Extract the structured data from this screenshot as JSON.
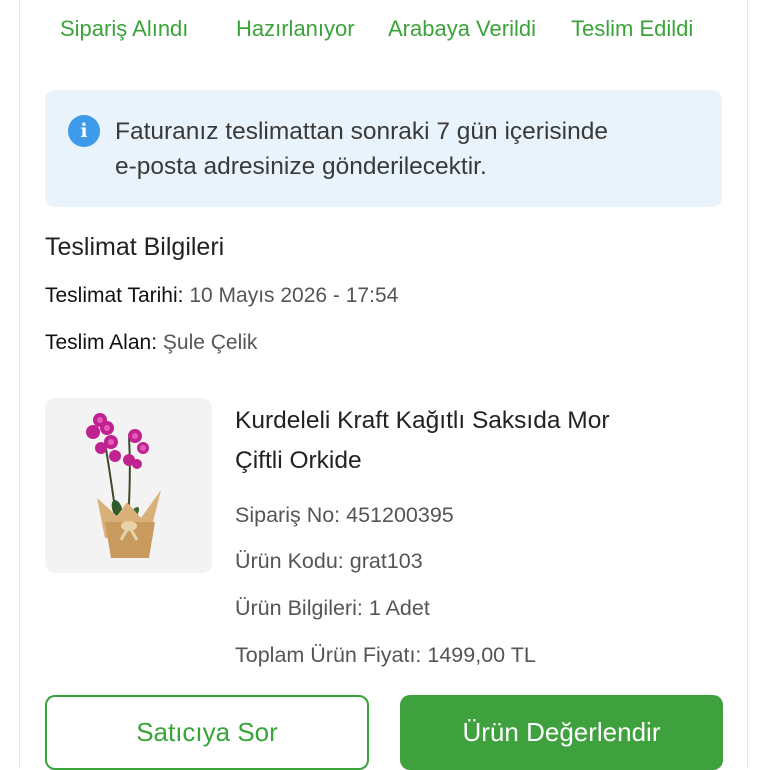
{
  "order_steps": [
    "Sipariş Alındı",
    "Hazırlanıyor",
    "Arabaya Verildi",
    "Teslim Edildi"
  ],
  "colors": {
    "accent": "#3aa33a",
    "info_bg": "#e9f3fb",
    "info_icon": "#3d9be9"
  },
  "info_notice": {
    "icon": "info-icon",
    "line1": "Faturanız teslimattan sonraki 7 gün içerisinde",
    "line2": "e-posta adresinize gönderilecektir."
  },
  "delivery": {
    "title": "Teslimat Bilgileri",
    "date_label": "Teslimat Tarihi:",
    "date_value": "10 Mayıs 2026 - 17:54",
    "receiver_label": "Teslim Alan:",
    "receiver_value": "Şule Çelik"
  },
  "product": {
    "name_line1": "Kurdeleli Kraft Kağıtlı Saksıda Mor",
    "name_line2": "Çiftli Orkide",
    "order_no_label": "Sipariş No:",
    "order_no": "451200395",
    "code_label": "Ürün Kodu:",
    "code": "grat103",
    "info_label": "Ürün Bilgileri:",
    "info": "1 Adet",
    "price_label": "Toplam Ürün Fiyatı:",
    "price": "1499,00 TL"
  },
  "actions": {
    "ask_seller": "Satıcıya Sor",
    "rate_product": "Ürün Değerlendir"
  }
}
